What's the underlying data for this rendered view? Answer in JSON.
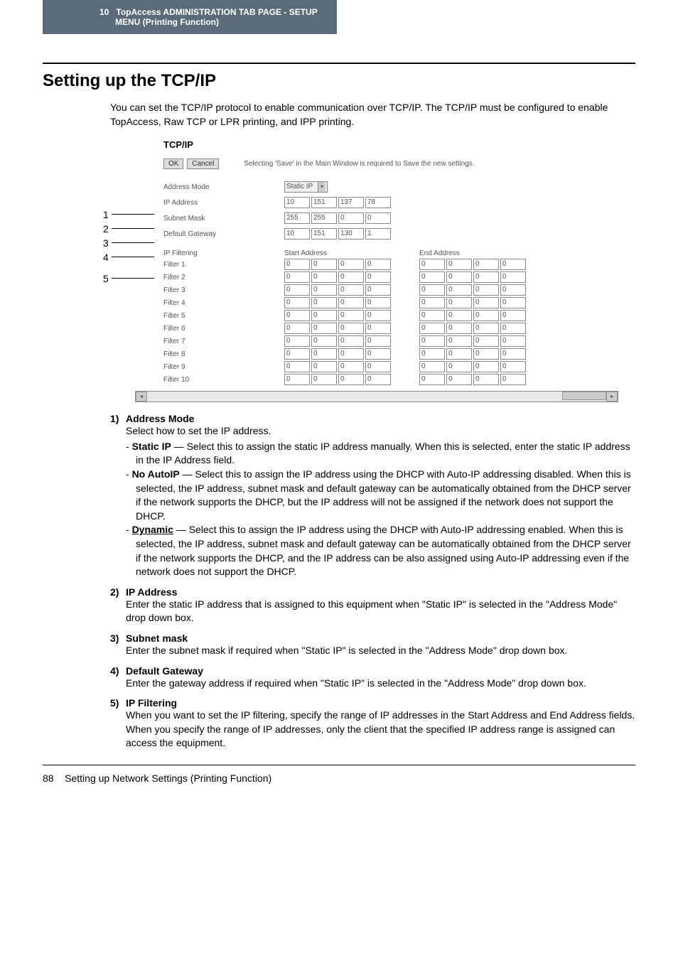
{
  "header": {
    "chapter_num": "10",
    "chapter_title_line1": "TopAccess ADMINISTRATION TAB PAGE - SETUP",
    "chapter_title_line2": "MENU (Printing Function)"
  },
  "title": "Setting up the TCP/IP",
  "intro": "You can set the TCP/IP protocol to enable communication over TCP/IP.  The TCP/IP must be configured to enable TopAccess, Raw TCP or LPR printing, and IPP printing.",
  "callouts": [
    "1",
    "2",
    "3",
    "4",
    "5"
  ],
  "screenshot": {
    "section_title": "TCP/IP",
    "ok": "OK",
    "cancel": "Cancel",
    "save_note": "Selecting 'Save' in the Main Window is required to Save the new settings.",
    "rows": {
      "address_mode": {
        "label": "Address Mode",
        "value": "Static IP"
      },
      "ip_address": {
        "label": "IP Address",
        "octets": [
          "10",
          "151",
          "137",
          "78"
        ]
      },
      "subnet_mask": {
        "label": "Subnet Mask",
        "octets": [
          "255",
          "255",
          "0",
          "0"
        ]
      },
      "default_gw": {
        "label": "Default Gateway",
        "octets": [
          "10",
          "151",
          "130",
          "1"
        ]
      }
    },
    "filtering": {
      "header_label": "IP Filtering",
      "start_label": "Start Address",
      "end_label": "End Address",
      "filters": [
        {
          "name": "Filter 1",
          "start": [
            "0",
            "0",
            "0",
            "0"
          ],
          "end": [
            "0",
            "0",
            "0",
            "0"
          ]
        },
        {
          "name": "Filter 2",
          "start": [
            "0",
            "0",
            "0",
            "0"
          ],
          "end": [
            "0",
            "0",
            "0",
            "0"
          ]
        },
        {
          "name": "Filter 3",
          "start": [
            "0",
            "0",
            "0",
            "0"
          ],
          "end": [
            "0",
            "0",
            "0",
            "0"
          ]
        },
        {
          "name": "Filter 4",
          "start": [
            "0",
            "0",
            "0",
            "0"
          ],
          "end": [
            "0",
            "0",
            "0",
            "0"
          ]
        },
        {
          "name": "Filter 5",
          "start": [
            "0",
            "0",
            "0",
            "0"
          ],
          "end": [
            "0",
            "0",
            "0",
            "0"
          ]
        },
        {
          "name": "Filter 6",
          "start": [
            "0",
            "0",
            "0",
            "0"
          ],
          "end": [
            "0",
            "0",
            "0",
            "0"
          ]
        },
        {
          "name": "Filter 7",
          "start": [
            "0",
            "0",
            "0",
            "0"
          ],
          "end": [
            "0",
            "0",
            "0",
            "0"
          ]
        },
        {
          "name": "Filter 8",
          "start": [
            "0",
            "0",
            "0",
            "0"
          ],
          "end": [
            "0",
            "0",
            "0",
            "0"
          ]
        },
        {
          "name": "Filter 9",
          "start": [
            "0",
            "0",
            "0",
            "0"
          ],
          "end": [
            "0",
            "0",
            "0",
            "0"
          ]
        },
        {
          "name": "Filter 10",
          "start": [
            "0",
            "0",
            "0",
            "0"
          ],
          "end": [
            "0",
            "0",
            "0",
            "0"
          ]
        }
      ]
    }
  },
  "descriptions": [
    {
      "num": "1)",
      "title": "Address Mode",
      "lead": "Select how to set the IP address.",
      "items": [
        {
          "term": "Static IP",
          "underline": false,
          "text": " — Select this to assign the static IP address manually.  When this is selected, enter the static IP address in the IP Address field."
        },
        {
          "term": "No AutoIP",
          "underline": false,
          "text": " — Select this to assign the IP address using the DHCP with Auto-IP addressing disabled. When this is selected, the IP address, subnet mask and default gateway can be automatically obtained from the DHCP server if the network supports the DHCP, but the IP address will not be assigned if the network does not support the DHCP."
        },
        {
          "term": "Dynamic",
          "underline": true,
          "text": " — Select this to assign the IP address using the DHCP with Auto-IP addressing enabled.  When this is selected, the IP address, subnet mask and default gateway can be automatically obtained from the DHCP server if the network supports the DHCP, and the IP address can be also assigned using Auto-IP addressing even if the network does not support the DHCP."
        }
      ]
    },
    {
      "num": "2)",
      "title": "IP Address",
      "lead": "Enter the static IP address that is assigned to this equipment when \"Static IP\" is selected in the \"Address Mode\" drop down box."
    },
    {
      "num": "3)",
      "title": "Subnet mask",
      "lead": "Enter the subnet mask if required when \"Static IP\" is selected in the \"Address Mode\" drop down box."
    },
    {
      "num": "4)",
      "title": "Default Gateway",
      "lead": "Enter the gateway address if required when \"Static IP\" is selected in the \"Address Mode\" drop down box."
    },
    {
      "num": "5)",
      "title": "IP Filtering",
      "lead": "When you want to set the IP filtering, specify the range of IP addresses in the Start Address and End Address fields.",
      "lead2": "When you specify the range of IP addresses, only the client that the specified IP address range is assigned can access the equipment."
    }
  ],
  "footer": {
    "page_num": "88",
    "page_title": "Setting up Network Settings (Printing Function)"
  }
}
